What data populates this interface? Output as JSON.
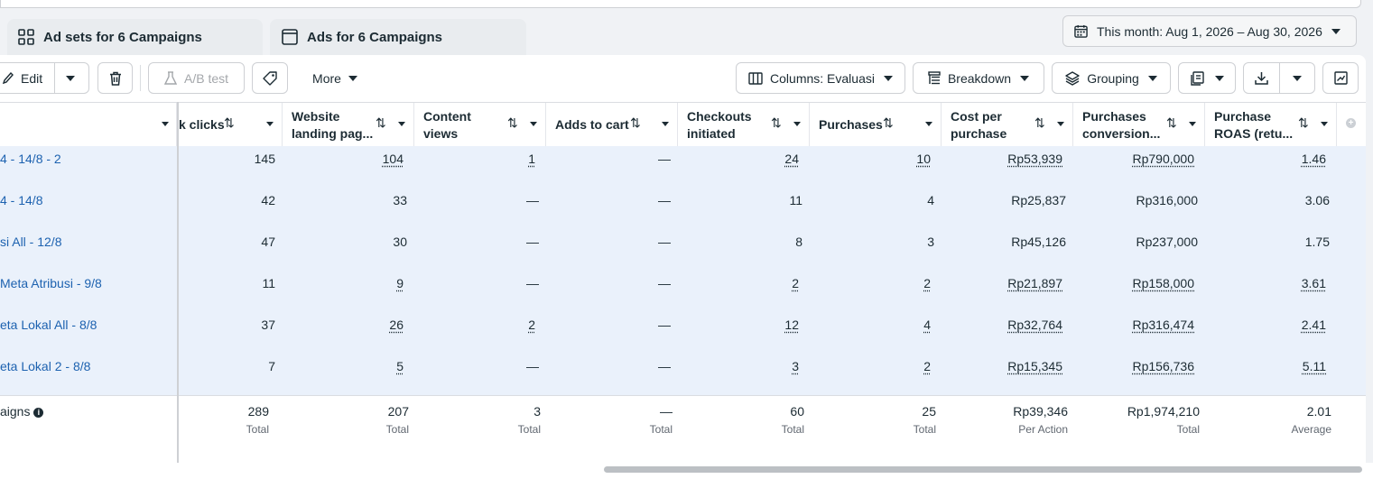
{
  "tabs": [
    {
      "label": "Ad sets for 6 Campaigns",
      "icon": "grid-icon"
    },
    {
      "label": "Ads for 6 Campaigns",
      "icon": "ad-icon"
    }
  ],
  "date_range": {
    "label": "This month: Aug 1, 2026 – Aug 30, 2026",
    "icon": "calendar-icon"
  },
  "toolbar": {
    "edit_label": "Edit",
    "ab_test_label": "A/B test",
    "more_label": "More",
    "columns_label": "Columns: Evaluasi",
    "breakdown_label": "Breakdown",
    "grouping_label": "Grouping"
  },
  "columns": [
    {
      "label": "k clicks"
    },
    {
      "label": "Website landing pag..."
    },
    {
      "label": "Content views"
    },
    {
      "label": "Adds to cart"
    },
    {
      "label": "Checkouts initiated"
    },
    {
      "label": "Purchases"
    },
    {
      "label": "Cost per purchase"
    },
    {
      "label": "Purchases conversion..."
    },
    {
      "label": "Purchase ROAS (retu..."
    }
  ],
  "rows": [
    {
      "name": "4 - 14/8 - 2",
      "link_clicks": "145",
      "landing": "104",
      "content_views": "1",
      "adds_to_cart": "—",
      "checkouts": "24",
      "purchases": "10",
      "cost_per_purchase": "Rp53,939",
      "conversion_value": "Rp790,000",
      "roas": "1.46"
    },
    {
      "name": "4 - 14/8",
      "link_clicks": "42",
      "landing": "33",
      "content_views": "—",
      "adds_to_cart": "—",
      "checkouts": "11",
      "purchases": "4",
      "cost_per_purchase": "Rp25,837",
      "conversion_value": "Rp316,000",
      "roas": "3.06"
    },
    {
      "name": "si All - 12/8",
      "link_clicks": "47",
      "landing": "30",
      "content_views": "—",
      "adds_to_cart": "—",
      "checkouts": "8",
      "purchases": "3",
      "cost_per_purchase": "Rp45,126",
      "conversion_value": "Rp237,000",
      "roas": "1.75"
    },
    {
      "name": "Meta Atribusi - 9/8",
      "link_clicks": "11",
      "landing": "9",
      "content_views": "—",
      "adds_to_cart": "—",
      "checkouts": "2",
      "purchases": "2",
      "cost_per_purchase": "Rp21,897",
      "conversion_value": "Rp158,000",
      "roas": "3.61"
    },
    {
      "name": "eta Lokal All - 8/8",
      "link_clicks": "37",
      "landing": "26",
      "content_views": "2",
      "adds_to_cart": "—",
      "checkouts": "12",
      "purchases": "4",
      "cost_per_purchase": "Rp32,764",
      "conversion_value": "Rp316,474",
      "roas": "2.41"
    },
    {
      "name": "eta Lokal 2 - 8/8",
      "link_clicks": "7",
      "landing": "5",
      "content_views": "—",
      "adds_to_cart": "—",
      "checkouts": "3",
      "purchases": "2",
      "cost_per_purchase": "Rp15,345",
      "conversion_value": "Rp156,736",
      "roas": "5.11"
    }
  ],
  "totals": {
    "name": "aigns",
    "info_icon": "info-icon",
    "link_clicks": {
      "value": "289",
      "label": "Total"
    },
    "landing": {
      "value": "207",
      "label": "Total"
    },
    "content_views": {
      "value": "3",
      "label": "Total"
    },
    "adds_to_cart": {
      "value": "—",
      "label": "Total"
    },
    "checkouts": {
      "value": "60",
      "label": "Total"
    },
    "purchases": {
      "value": "25",
      "label": "Total"
    },
    "cost_per_purchase": {
      "value": "Rp39,346",
      "label": "Per Action"
    },
    "conversion_value": {
      "value": "Rp1,974,210",
      "label": "Total"
    },
    "roas": {
      "value": "2.01",
      "label": "Average"
    }
  },
  "colors": {
    "link": "#1d62b0",
    "row_highlight": "#eaf1fb",
    "border": "#ced0d4"
  }
}
